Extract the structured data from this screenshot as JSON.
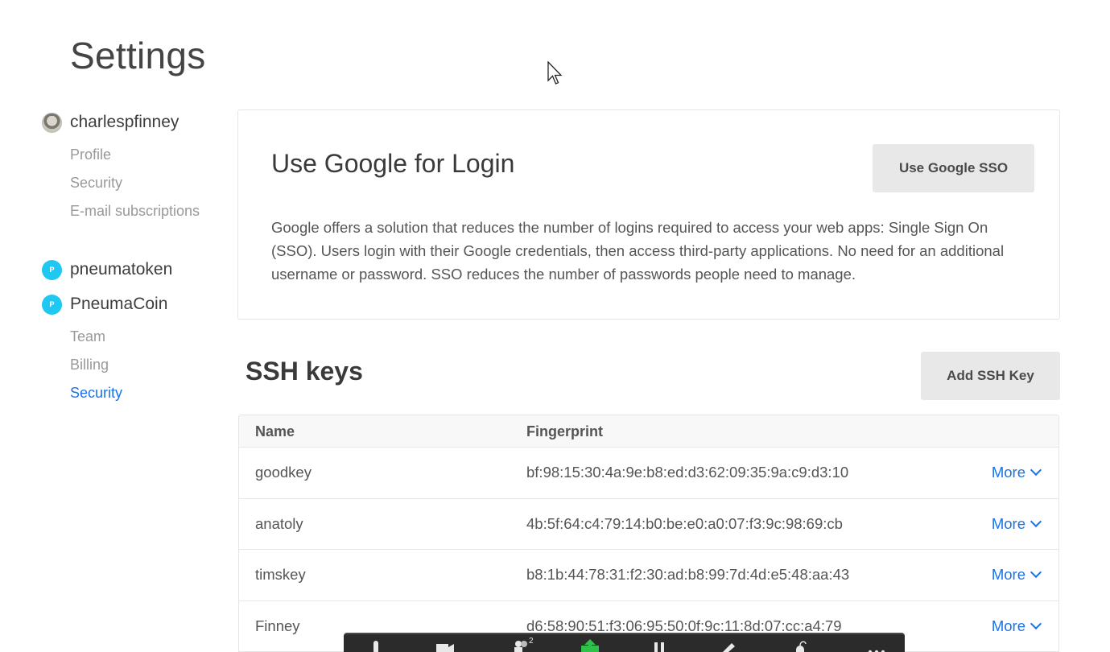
{
  "page": {
    "title": "Settings"
  },
  "sidebar": {
    "user": {
      "name": "charlespfinney",
      "items": [
        "Profile",
        "Security",
        "E-mail subscriptions"
      ]
    },
    "orgs": [
      {
        "badge": "P",
        "name": "pneumatoken"
      },
      {
        "badge": "P",
        "name": "PneumaCoin",
        "items": [
          "Team",
          "Billing",
          "Security"
        ],
        "active": "Security"
      }
    ]
  },
  "google_sso": {
    "title": "Use Google for Login",
    "button": "Use Google SSO",
    "description": "Google offers a solution that reduces the number of logins required to access your web apps: Single Sign On (SSO). Users login with their Google credentials, then access third-party applications. No need for an additional username or password. SSO reduces the number of passwords people need to manage."
  },
  "ssh": {
    "title": "SSH keys",
    "add_button": "Add SSH Key",
    "columns": [
      "Name",
      "Fingerprint"
    ],
    "rows": [
      {
        "name": "goodkey",
        "fingerprint": "bf:98:15:30:4a:9e:b8:ed:d3:62:09:35:9a:c9:d3:10",
        "action": "More"
      },
      {
        "name": "anatoly",
        "fingerprint": "4b:5f:64:c4:79:14:b0:be:e0:a0:07:f3:9c:98:69:cb",
        "action": "More"
      },
      {
        "name": "timskey",
        "fingerprint": "b8:1b:44:78:31:f2:30:ad:b8:99:7d:4d:e5:48:aa:43",
        "action": "More"
      },
      {
        "name": "Finney",
        "fingerprint": "d6:58:90:51:f3:06:95:50:0f:9c:11:8d:07:cc:a4:79",
        "action": "More"
      }
    ]
  },
  "toolbar": {
    "participants_count": "2",
    "icons": [
      "microphone-icon",
      "video-icon",
      "participants-icon",
      "share-screen-icon",
      "pause-icon",
      "annotate-icon",
      "remote-control-icon",
      "more-icon"
    ]
  },
  "colors": {
    "accent": "#1a73e8",
    "org_badge": "#1ec8f0",
    "button_bg": "#e8e8e8"
  }
}
